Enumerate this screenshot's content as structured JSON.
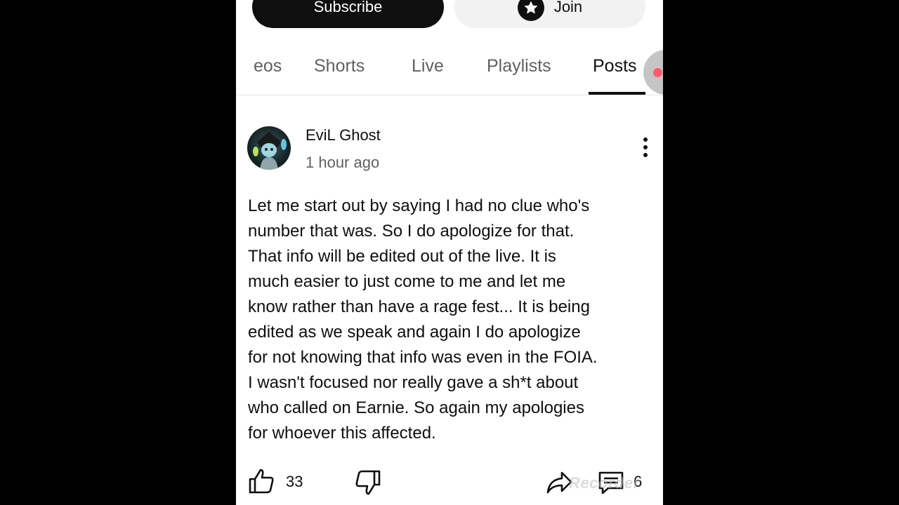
{
  "header": {
    "subscribe_label": "Subscribe",
    "join_label": "Join"
  },
  "tabs": [
    {
      "label": "eos"
    },
    {
      "label": "Shorts"
    },
    {
      "label": "Live"
    },
    {
      "label": "Playlists"
    },
    {
      "label": "Posts",
      "active": true
    }
  ],
  "post": {
    "author": "EviL Ghost",
    "time": "1 hour ago",
    "lines": [
      "Let me start out by saying I had no clue who's",
      "number that was. So I do apologize for that.",
      "That info will be edited out of the live. It is",
      "much easier to just come to me and let me",
      "know rather than have a rage fest... It is being",
      "edited as we speak and again I do apologize",
      "for not knowing that info was even in the FOIA.",
      "I wasn't focused nor really gave a sh*t about",
      "who called on Earnie. So again my apologies",
      "for whoever this affected."
    ],
    "like_count": "33",
    "comment_count": "6"
  },
  "watermark": "Recorder",
  "colors": {
    "background": "#000000",
    "panel": "#ffffff",
    "text_primary": "#0f0f0f",
    "text_secondary": "#606060",
    "join_bg": "#f2f2f2",
    "indicator_dot": "#ff5a6e"
  }
}
